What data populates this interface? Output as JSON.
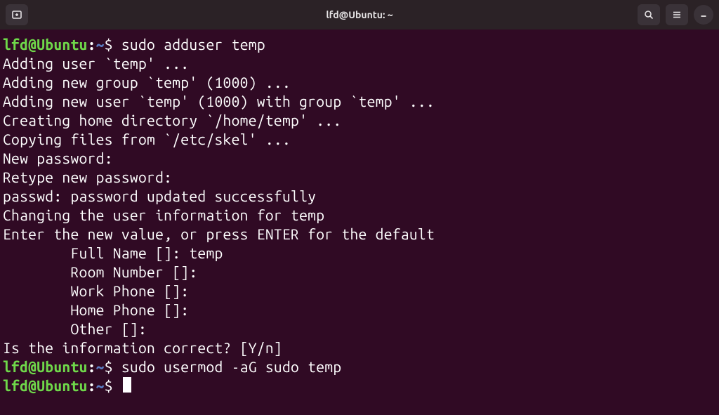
{
  "titlebar": {
    "title": "lfd@Ubuntu: ~"
  },
  "prompt": {
    "user_host": "lfd@Ubuntu",
    "colon": ":",
    "path": "~",
    "symbol": "$"
  },
  "lines": {
    "cmd1": " sudo adduser temp",
    "o1": "Adding user `temp' ...",
    "o2": "Adding new group `temp' (1000) ...",
    "o3": "Adding new user `temp' (1000) with group `temp' ...",
    "o4": "Creating home directory `/home/temp' ...",
    "o5": "Copying files from `/etc/skel' ...",
    "o6": "New password:",
    "o7": "Retype new password:",
    "o8": "passwd: password updated successfully",
    "o9": "Changing the user information for temp",
    "o10": "Enter the new value, or press ENTER for the default",
    "o11": "        Full Name []: temp",
    "o12": "        Room Number []:",
    "o13": "        Work Phone []:",
    "o14": "        Home Phone []:",
    "o15": "        Other []:",
    "o16": "Is the information correct? [Y/n]",
    "cmd2": " sudo usermod -aG sudo temp",
    "cmd3": " "
  }
}
